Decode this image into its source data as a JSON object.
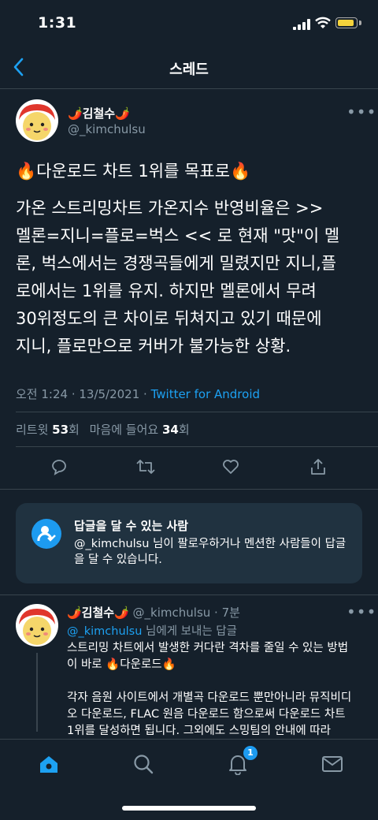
{
  "status_bar": {
    "time": "1:31"
  },
  "header": {
    "title": "스레드"
  },
  "tweet": {
    "author_name": "🌶️김철수🌶️",
    "author_handle": "@_kimchulsu",
    "headline": "🔥다운로드 차트 1위를 목표로🔥",
    "body_lines": [
      "가온 스트리밍차트 가온지수 반영비율은 >>",
      "멜론=지니=플로=벅스 << 로 현재 \"맛\"이 멜",
      "론, 벅스에서는 경쟁곡들에게 밀렸지만 지니,플",
      "로에서는 1위를 유지. 하지만 멜론에서 무려",
      "30위정도의 큰 차이로 뒤쳐지고 있기 때문에",
      "지니, 플로만으로 커버가 불가능한 상황."
    ],
    "timestamp": "오전 1:24 · 13/5/2021 · ",
    "source": "Twitter for Android",
    "retweets_label": "리트윗 ",
    "retweets_count": "53",
    "retweets_suffix": "회",
    "likes_label": "마음에 들어요 ",
    "likes_count": "34",
    "likes_suffix": "회"
  },
  "reply_card": {
    "title": "답글을 달 수 있는 사람",
    "body": "@_kimchulsu 님이 팔로우하거나 멘션한 사람들이 답글을 달 수 있습니다."
  },
  "reply": {
    "author_name": "🌶️김철수🌶️",
    "author_handle": "@_kimchulsu · 7분",
    "reply_to_handle": "@_kimchulsu",
    "reply_to_suffix": " 님에게 보내는 답글",
    "lines": [
      "스트리밍 차트에서 발생한 커다란 격차를 줄일 수 있는 방법",
      "이 바로 🔥다운로드🔥",
      "",
      "각자 음원 사이트에서 개별곡 다운로드 뿐만아니라 뮤직비디",
      "오 다운로드, FLAC 원음 다운로드 함으로써 다운로드 차트",
      "1위를 달성하면 됩니다. 그외에도 스밍팀의 안내에 따라"
    ]
  },
  "tab_bar": {
    "notification_badge": "1"
  },
  "colors": {
    "background": "#15202b",
    "accent": "#1da1f2",
    "muted": "#8899a6",
    "divider": "#38444d"
  }
}
